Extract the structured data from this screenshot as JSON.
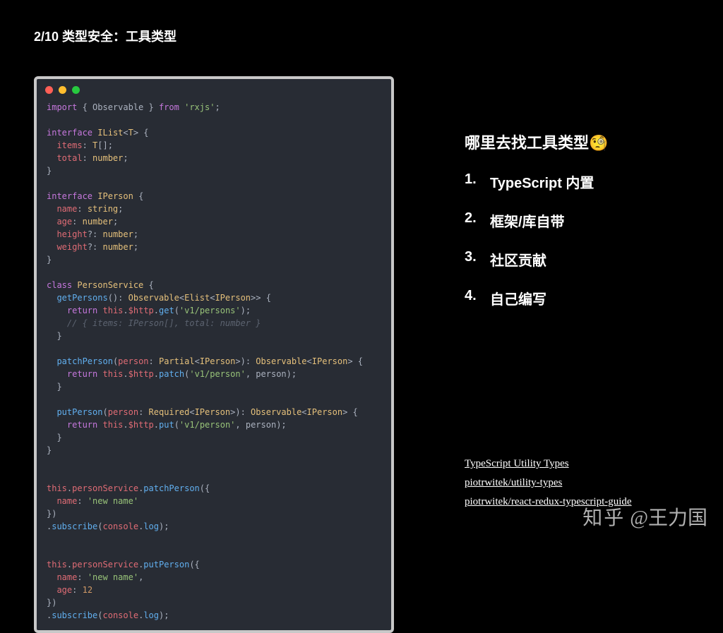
{
  "header": {
    "title": "2/10 类型安全：工具类型"
  },
  "code": {
    "lines": [
      [
        {
          "t": "import",
          "c": "kw"
        },
        {
          "t": " { Observable } ",
          "c": "punct"
        },
        {
          "t": "from",
          "c": "kw"
        },
        {
          "t": " ",
          "c": ""
        },
        {
          "t": "'rxjs'",
          "c": "str"
        },
        {
          "t": ";",
          "c": "punct"
        }
      ],
      [],
      [
        {
          "t": "interface",
          "c": "kw"
        },
        {
          "t": " ",
          "c": ""
        },
        {
          "t": "IList",
          "c": "cls"
        },
        {
          "t": "<",
          "c": "punct"
        },
        {
          "t": "T",
          "c": "cls"
        },
        {
          "t": "> {",
          "c": "punct"
        }
      ],
      [
        {
          "t": "  ",
          "c": ""
        },
        {
          "t": "items",
          "c": "prop"
        },
        {
          "t": ": ",
          "c": "punct"
        },
        {
          "t": "T",
          "c": "cls"
        },
        {
          "t": "[];",
          "c": "punct"
        }
      ],
      [
        {
          "t": "  ",
          "c": ""
        },
        {
          "t": "total",
          "c": "prop"
        },
        {
          "t": ": ",
          "c": "punct"
        },
        {
          "t": "number",
          "c": "cls"
        },
        {
          "t": ";",
          "c": "punct"
        }
      ],
      [
        {
          "t": "}",
          "c": "punct"
        }
      ],
      [],
      [
        {
          "t": "interface",
          "c": "kw"
        },
        {
          "t": " ",
          "c": ""
        },
        {
          "t": "IPerson",
          "c": "cls"
        },
        {
          "t": " {",
          "c": "punct"
        }
      ],
      [
        {
          "t": "  ",
          "c": ""
        },
        {
          "t": "name",
          "c": "prop"
        },
        {
          "t": ": ",
          "c": "punct"
        },
        {
          "t": "string",
          "c": "cls"
        },
        {
          "t": ";",
          "c": "punct"
        }
      ],
      [
        {
          "t": "  ",
          "c": ""
        },
        {
          "t": "age",
          "c": "prop"
        },
        {
          "t": ": ",
          "c": "punct"
        },
        {
          "t": "number",
          "c": "cls"
        },
        {
          "t": ";",
          "c": "punct"
        }
      ],
      [
        {
          "t": "  ",
          "c": ""
        },
        {
          "t": "height",
          "c": "prop"
        },
        {
          "t": "?: ",
          "c": "punct"
        },
        {
          "t": "number",
          "c": "cls"
        },
        {
          "t": ";",
          "c": "punct"
        }
      ],
      [
        {
          "t": "  ",
          "c": ""
        },
        {
          "t": "weight",
          "c": "prop"
        },
        {
          "t": "?: ",
          "c": "punct"
        },
        {
          "t": "number",
          "c": "cls"
        },
        {
          "t": ";",
          "c": "punct"
        }
      ],
      [
        {
          "t": "}",
          "c": "punct"
        }
      ],
      [],
      [
        {
          "t": "class",
          "c": "kw"
        },
        {
          "t": " ",
          "c": ""
        },
        {
          "t": "PersonService",
          "c": "cls"
        },
        {
          "t": " {",
          "c": "punct"
        }
      ],
      [
        {
          "t": "  ",
          "c": ""
        },
        {
          "t": "getPersons",
          "c": "fn"
        },
        {
          "t": "(): ",
          "c": "punct"
        },
        {
          "t": "Observable",
          "c": "cls"
        },
        {
          "t": "<",
          "c": "punct"
        },
        {
          "t": "Elist",
          "c": "cls"
        },
        {
          "t": "<",
          "c": "punct"
        },
        {
          "t": "IPerson",
          "c": "cls"
        },
        {
          "t": ">> {",
          "c": "punct"
        }
      ],
      [
        {
          "t": "    ",
          "c": ""
        },
        {
          "t": "return",
          "c": "kw"
        },
        {
          "t": " ",
          "c": ""
        },
        {
          "t": "this",
          "c": "var"
        },
        {
          "t": ".",
          "c": "punct"
        },
        {
          "t": "$http",
          "c": "prop"
        },
        {
          "t": ".",
          "c": "punct"
        },
        {
          "t": "get",
          "c": "fn"
        },
        {
          "t": "(",
          "c": "punct"
        },
        {
          "t": "'v1/persons'",
          "c": "str"
        },
        {
          "t": ");",
          "c": "punct"
        }
      ],
      [
        {
          "t": "    ",
          "c": ""
        },
        {
          "t": "// { items: IPerson[], total: number }",
          "c": "comment"
        }
      ],
      [
        {
          "t": "  }",
          "c": "punct"
        }
      ],
      [],
      [
        {
          "t": "  ",
          "c": ""
        },
        {
          "t": "patchPerson",
          "c": "fn"
        },
        {
          "t": "(",
          "c": "punct"
        },
        {
          "t": "person",
          "c": "prop"
        },
        {
          "t": ": ",
          "c": "punct"
        },
        {
          "t": "Partial",
          "c": "cls"
        },
        {
          "t": "<",
          "c": "punct"
        },
        {
          "t": "IPerson",
          "c": "cls"
        },
        {
          "t": ">): ",
          "c": "punct"
        },
        {
          "t": "Observable",
          "c": "cls"
        },
        {
          "t": "<",
          "c": "punct"
        },
        {
          "t": "IPerson",
          "c": "cls"
        },
        {
          "t": "> {",
          "c": "punct"
        }
      ],
      [
        {
          "t": "    ",
          "c": ""
        },
        {
          "t": "return",
          "c": "kw"
        },
        {
          "t": " ",
          "c": ""
        },
        {
          "t": "this",
          "c": "var"
        },
        {
          "t": ".",
          "c": "punct"
        },
        {
          "t": "$http",
          "c": "prop"
        },
        {
          "t": ".",
          "c": "punct"
        },
        {
          "t": "patch",
          "c": "fn"
        },
        {
          "t": "(",
          "c": "punct"
        },
        {
          "t": "'v1/person'",
          "c": "str"
        },
        {
          "t": ", person);",
          "c": "punct"
        }
      ],
      [
        {
          "t": "  }",
          "c": "punct"
        }
      ],
      [],
      [
        {
          "t": "  ",
          "c": ""
        },
        {
          "t": "putPerson",
          "c": "fn"
        },
        {
          "t": "(",
          "c": "punct"
        },
        {
          "t": "person",
          "c": "prop"
        },
        {
          "t": ": ",
          "c": "punct"
        },
        {
          "t": "Required",
          "c": "cls"
        },
        {
          "t": "<",
          "c": "punct"
        },
        {
          "t": "IPerson",
          "c": "cls"
        },
        {
          "t": ">): ",
          "c": "punct"
        },
        {
          "t": "Observable",
          "c": "cls"
        },
        {
          "t": "<",
          "c": "punct"
        },
        {
          "t": "IPerson",
          "c": "cls"
        },
        {
          "t": "> {",
          "c": "punct"
        }
      ],
      [
        {
          "t": "    ",
          "c": ""
        },
        {
          "t": "return",
          "c": "kw"
        },
        {
          "t": " ",
          "c": ""
        },
        {
          "t": "this",
          "c": "var"
        },
        {
          "t": ".",
          "c": "punct"
        },
        {
          "t": "$http",
          "c": "prop"
        },
        {
          "t": ".",
          "c": "punct"
        },
        {
          "t": "put",
          "c": "fn"
        },
        {
          "t": "(",
          "c": "punct"
        },
        {
          "t": "'v1/person'",
          "c": "str"
        },
        {
          "t": ", person);",
          "c": "punct"
        }
      ],
      [
        {
          "t": "  }",
          "c": "punct"
        }
      ],
      [
        {
          "t": "}",
          "c": "punct"
        }
      ],
      [],
      [],
      [
        {
          "t": "this",
          "c": "var"
        },
        {
          "t": ".",
          "c": "punct"
        },
        {
          "t": "personService",
          "c": "prop"
        },
        {
          "t": ".",
          "c": "punct"
        },
        {
          "t": "patchPerson",
          "c": "fn"
        },
        {
          "t": "({",
          "c": "punct"
        }
      ],
      [
        {
          "t": "  ",
          "c": ""
        },
        {
          "t": "name",
          "c": "prop"
        },
        {
          "t": ": ",
          "c": "punct"
        },
        {
          "t": "'new name'",
          "c": "str"
        }
      ],
      [
        {
          "t": "})",
          "c": "punct"
        }
      ],
      [
        {
          "t": ".",
          "c": "punct"
        },
        {
          "t": "subscribe",
          "c": "fn"
        },
        {
          "t": "(",
          "c": "punct"
        },
        {
          "t": "console",
          "c": "var"
        },
        {
          "t": ".",
          "c": "punct"
        },
        {
          "t": "log",
          "c": "fn"
        },
        {
          "t": ");",
          "c": "punct"
        }
      ],
      [],
      [],
      [
        {
          "t": "this",
          "c": "var"
        },
        {
          "t": ".",
          "c": "punct"
        },
        {
          "t": "personService",
          "c": "prop"
        },
        {
          "t": ".",
          "c": "punct"
        },
        {
          "t": "putPerson",
          "c": "fn"
        },
        {
          "t": "({",
          "c": "punct"
        }
      ],
      [
        {
          "t": "  ",
          "c": ""
        },
        {
          "t": "name",
          "c": "prop"
        },
        {
          "t": ": ",
          "c": "punct"
        },
        {
          "t": "'new name'",
          "c": "str"
        },
        {
          "t": ",",
          "c": "punct"
        }
      ],
      [
        {
          "t": "  ",
          "c": ""
        },
        {
          "t": "age",
          "c": "prop"
        },
        {
          "t": ": ",
          "c": "punct"
        },
        {
          "t": "12",
          "c": "num"
        }
      ],
      [
        {
          "t": "})",
          "c": "punct"
        }
      ],
      [
        {
          "t": ".",
          "c": "punct"
        },
        {
          "t": "subscribe",
          "c": "fn"
        },
        {
          "t": "(",
          "c": "punct"
        },
        {
          "t": "console",
          "c": "var"
        },
        {
          "t": ".",
          "c": "punct"
        },
        {
          "t": "log",
          "c": "fn"
        },
        {
          "t": ");",
          "c": "punct"
        }
      ]
    ]
  },
  "right": {
    "heading": "哪里去找工具类型🧐",
    "items": [
      {
        "num": "1.",
        "text": "TypeScript 内置"
      },
      {
        "num": "2.",
        "text": "框架/库自带"
      },
      {
        "num": "3.",
        "text": "社区贡献"
      },
      {
        "num": "4.",
        "text": "自己编写"
      }
    ]
  },
  "refs": [
    "TypeScript Utility Types",
    "piotrwitek/utility-types",
    "piotrwitek/react-redux-typescript-guide"
  ],
  "watermark": {
    "logo": "知乎",
    "author": "@王力国"
  }
}
